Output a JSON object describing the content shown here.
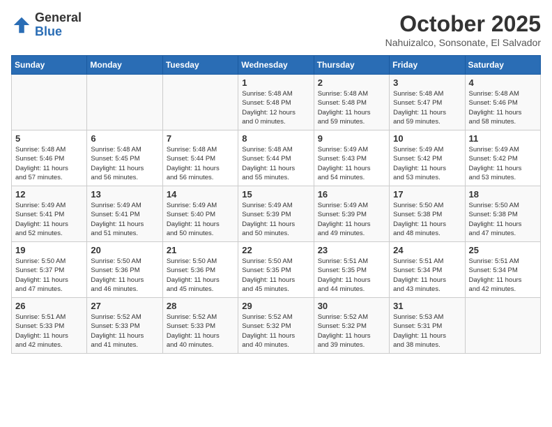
{
  "header": {
    "logo_general": "General",
    "logo_blue": "Blue",
    "month_title": "October 2025",
    "location": "Nahuizalco, Sonsonate, El Salvador"
  },
  "days_of_week": [
    "Sunday",
    "Monday",
    "Tuesday",
    "Wednesday",
    "Thursday",
    "Friday",
    "Saturday"
  ],
  "weeks": [
    [
      {
        "day": "",
        "info": ""
      },
      {
        "day": "",
        "info": ""
      },
      {
        "day": "",
        "info": ""
      },
      {
        "day": "1",
        "info": "Sunrise: 5:48 AM\nSunset: 5:48 PM\nDaylight: 12 hours\nand 0 minutes."
      },
      {
        "day": "2",
        "info": "Sunrise: 5:48 AM\nSunset: 5:48 PM\nDaylight: 11 hours\nand 59 minutes."
      },
      {
        "day": "3",
        "info": "Sunrise: 5:48 AM\nSunset: 5:47 PM\nDaylight: 11 hours\nand 59 minutes."
      },
      {
        "day": "4",
        "info": "Sunrise: 5:48 AM\nSunset: 5:46 PM\nDaylight: 11 hours\nand 58 minutes."
      }
    ],
    [
      {
        "day": "5",
        "info": "Sunrise: 5:48 AM\nSunset: 5:46 PM\nDaylight: 11 hours\nand 57 minutes."
      },
      {
        "day": "6",
        "info": "Sunrise: 5:48 AM\nSunset: 5:45 PM\nDaylight: 11 hours\nand 56 minutes."
      },
      {
        "day": "7",
        "info": "Sunrise: 5:48 AM\nSunset: 5:44 PM\nDaylight: 11 hours\nand 56 minutes."
      },
      {
        "day": "8",
        "info": "Sunrise: 5:48 AM\nSunset: 5:44 PM\nDaylight: 11 hours\nand 55 minutes."
      },
      {
        "day": "9",
        "info": "Sunrise: 5:49 AM\nSunset: 5:43 PM\nDaylight: 11 hours\nand 54 minutes."
      },
      {
        "day": "10",
        "info": "Sunrise: 5:49 AM\nSunset: 5:42 PM\nDaylight: 11 hours\nand 53 minutes."
      },
      {
        "day": "11",
        "info": "Sunrise: 5:49 AM\nSunset: 5:42 PM\nDaylight: 11 hours\nand 53 minutes."
      }
    ],
    [
      {
        "day": "12",
        "info": "Sunrise: 5:49 AM\nSunset: 5:41 PM\nDaylight: 11 hours\nand 52 minutes."
      },
      {
        "day": "13",
        "info": "Sunrise: 5:49 AM\nSunset: 5:41 PM\nDaylight: 11 hours\nand 51 minutes."
      },
      {
        "day": "14",
        "info": "Sunrise: 5:49 AM\nSunset: 5:40 PM\nDaylight: 11 hours\nand 50 minutes."
      },
      {
        "day": "15",
        "info": "Sunrise: 5:49 AM\nSunset: 5:39 PM\nDaylight: 11 hours\nand 50 minutes."
      },
      {
        "day": "16",
        "info": "Sunrise: 5:49 AM\nSunset: 5:39 PM\nDaylight: 11 hours\nand 49 minutes."
      },
      {
        "day": "17",
        "info": "Sunrise: 5:50 AM\nSunset: 5:38 PM\nDaylight: 11 hours\nand 48 minutes."
      },
      {
        "day": "18",
        "info": "Sunrise: 5:50 AM\nSunset: 5:38 PM\nDaylight: 11 hours\nand 47 minutes."
      }
    ],
    [
      {
        "day": "19",
        "info": "Sunrise: 5:50 AM\nSunset: 5:37 PM\nDaylight: 11 hours\nand 47 minutes."
      },
      {
        "day": "20",
        "info": "Sunrise: 5:50 AM\nSunset: 5:36 PM\nDaylight: 11 hours\nand 46 minutes."
      },
      {
        "day": "21",
        "info": "Sunrise: 5:50 AM\nSunset: 5:36 PM\nDaylight: 11 hours\nand 45 minutes."
      },
      {
        "day": "22",
        "info": "Sunrise: 5:50 AM\nSunset: 5:35 PM\nDaylight: 11 hours\nand 45 minutes."
      },
      {
        "day": "23",
        "info": "Sunrise: 5:51 AM\nSunset: 5:35 PM\nDaylight: 11 hours\nand 44 minutes."
      },
      {
        "day": "24",
        "info": "Sunrise: 5:51 AM\nSunset: 5:34 PM\nDaylight: 11 hours\nand 43 minutes."
      },
      {
        "day": "25",
        "info": "Sunrise: 5:51 AM\nSunset: 5:34 PM\nDaylight: 11 hours\nand 42 minutes."
      }
    ],
    [
      {
        "day": "26",
        "info": "Sunrise: 5:51 AM\nSunset: 5:33 PM\nDaylight: 11 hours\nand 42 minutes."
      },
      {
        "day": "27",
        "info": "Sunrise: 5:52 AM\nSunset: 5:33 PM\nDaylight: 11 hours\nand 41 minutes."
      },
      {
        "day": "28",
        "info": "Sunrise: 5:52 AM\nSunset: 5:33 PM\nDaylight: 11 hours\nand 40 minutes."
      },
      {
        "day": "29",
        "info": "Sunrise: 5:52 AM\nSunset: 5:32 PM\nDaylight: 11 hours\nand 40 minutes."
      },
      {
        "day": "30",
        "info": "Sunrise: 5:52 AM\nSunset: 5:32 PM\nDaylight: 11 hours\nand 39 minutes."
      },
      {
        "day": "31",
        "info": "Sunrise: 5:53 AM\nSunset: 5:31 PM\nDaylight: 11 hours\nand 38 minutes."
      },
      {
        "day": "",
        "info": ""
      }
    ]
  ]
}
